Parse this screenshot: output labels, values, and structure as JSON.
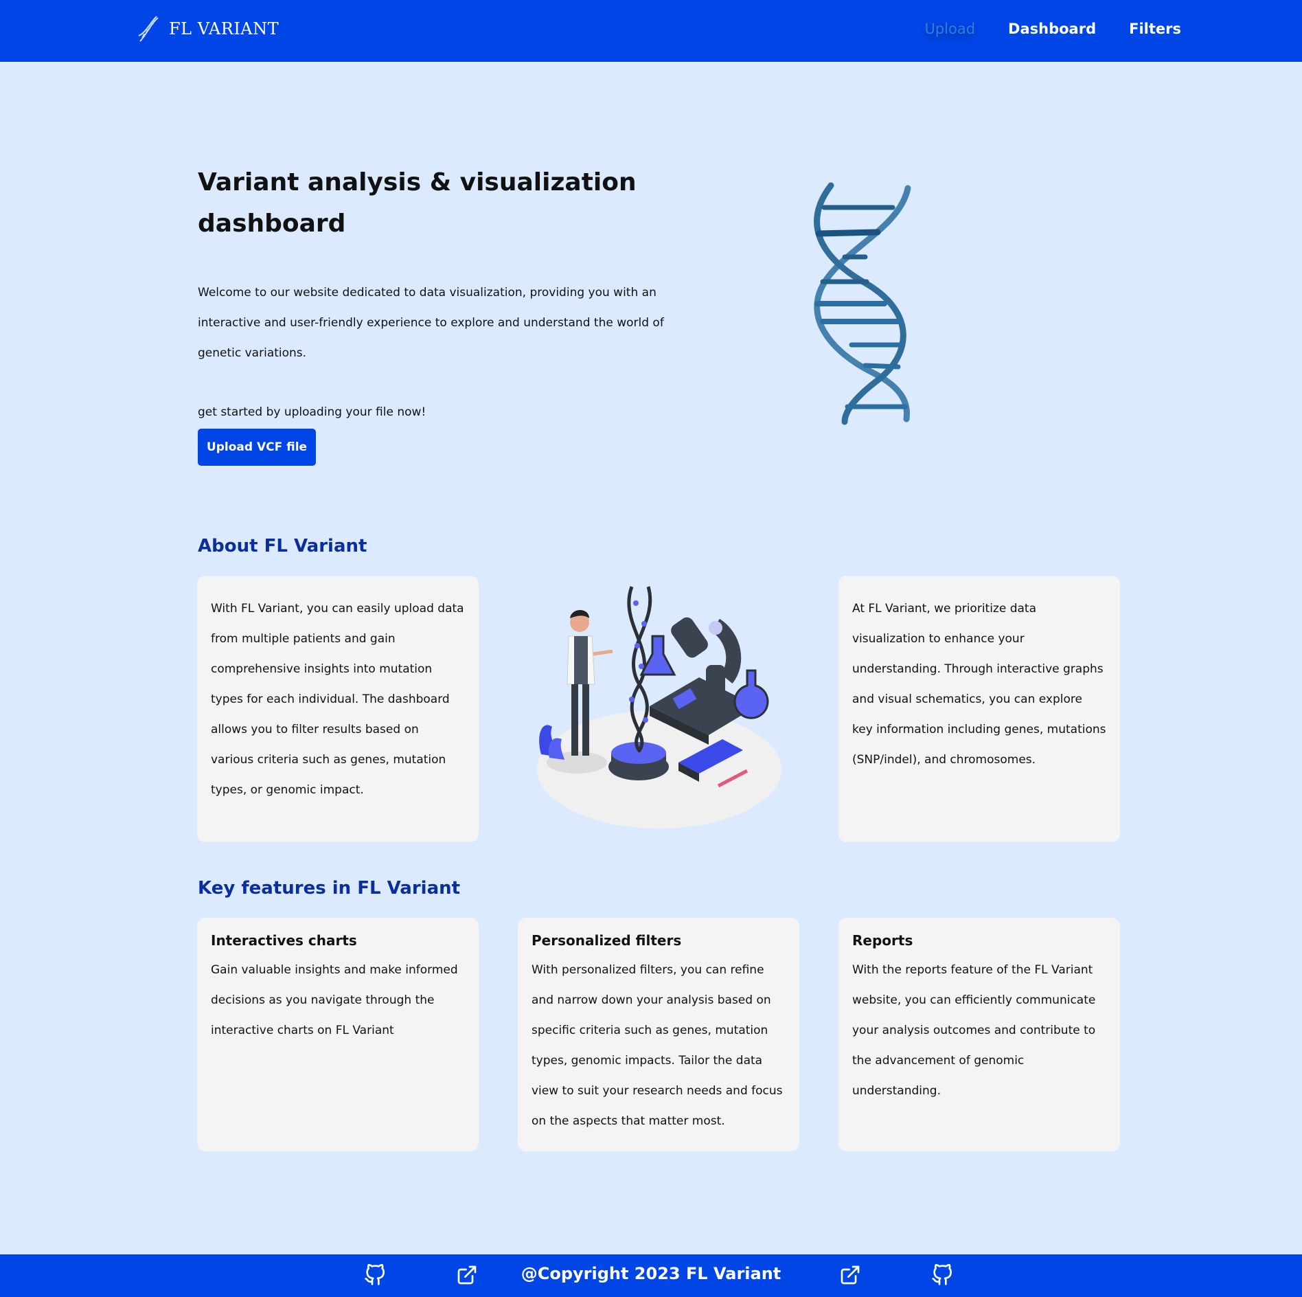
{
  "brand": {
    "name": "FL VARIANT",
    "icon": "dna-icon"
  },
  "nav": {
    "upload": "Upload",
    "dashboard": "Dashboard",
    "filters": "Filters"
  },
  "hero": {
    "title": "Variant analysis & visualization dashboard",
    "intro": "Welcome to our website dedicated to data visualization, providing you with an interactive and user-friendly experience to explore and understand the world of genetic variations.",
    "cta_text": "get started by uploading your file now!",
    "upload_button": "Upload VCF file"
  },
  "about": {
    "title": "About FL Variant",
    "left_card": "With FL Variant, you can easily upload data from multiple patients and gain comprehensive insights into mutation types for each individual. The dashboard allows you to filter results based on various criteria such as genes, mutation types, or genomic impact.",
    "right_card": "At FL Variant, we prioritize data visualization to enhance your understanding. Through interactive graphs and visual schematics, you can explore key information including genes, mutations (SNP/indel), and chromosomes."
  },
  "features": {
    "title": "Key features in FL Variant",
    "items": [
      {
        "title": "Interactives charts",
        "text": "Gain valuable insights and make informed decisions as you navigate through the interactive charts on FL Variant"
      },
      {
        "title": "Personalized filters",
        "text": "With personalized filters, you can refine and narrow down your analysis based on specific criteria such as genes, mutation types, genomic impacts. Tailor the data view to suit your research needs and focus on the aspects that matter most."
      },
      {
        "title": "Reports",
        "text": "With the reports feature of the FL Variant website, you can efficiently communicate your analysis outcomes and contribute to the advancement of genomic understanding."
      }
    ]
  },
  "footer": {
    "copyright": "@Copyright 2023 FL Variant",
    "icons": [
      "github-icon",
      "external-link-icon",
      "external-link-icon",
      "github-icon"
    ]
  },
  "colors": {
    "primary": "#0046e6",
    "background": "#dbeafe",
    "card": "#f4f4f5",
    "heading_blue": "#0a2f9c",
    "active_link": "#2f7fd9"
  }
}
